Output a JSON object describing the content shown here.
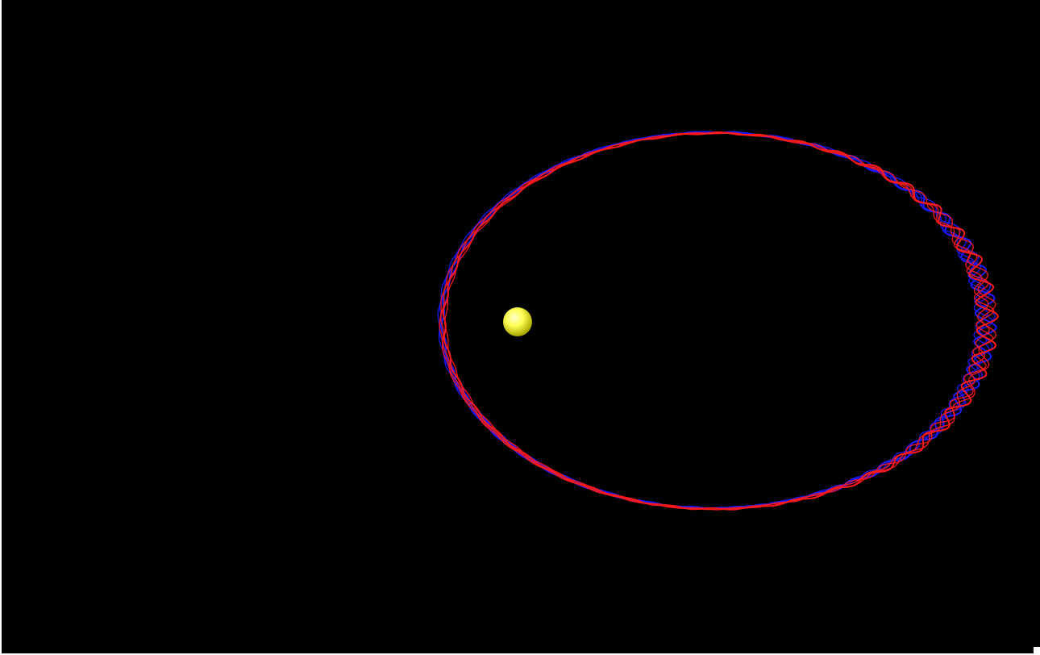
{
  "scene": {
    "background_color": "#000000",
    "central_body": {
      "name": "star",
      "color": "#ffff55",
      "highlight_color": "#ffffcc",
      "shadow_color": "#a8a800"
    },
    "orbits": [
      {
        "name": "orbit-trail-blue",
        "color": "#1a1aff"
      },
      {
        "name": "orbit-trail-red",
        "color": "#ff1a1a"
      }
    ]
  }
}
